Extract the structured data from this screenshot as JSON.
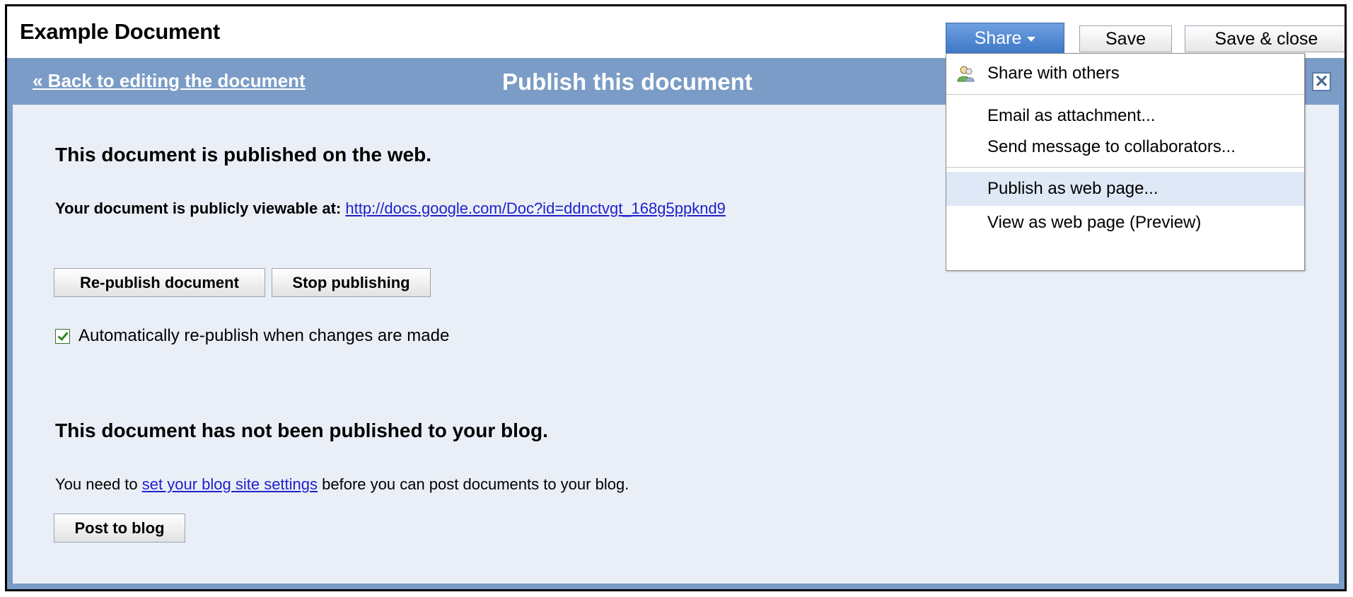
{
  "document": {
    "title": "Example Document"
  },
  "toolbar": {
    "share_label": "Share",
    "save_label": "Save",
    "save_close_label": "Save & close"
  },
  "publish_header": {
    "back_link": "« Back to editing the document",
    "title": "Publish this document",
    "close_icon": "close-x-icon"
  },
  "web_publish": {
    "heading": "This document is published on the web.",
    "viewable_prefix": "Your document is publicly viewable at:",
    "url": "http://docs.google.com/Doc?id=ddnctvgt_168g5ppknd9",
    "republish_button": "Re-publish document",
    "stop_button": "Stop publishing",
    "auto_republish_label": "Automatically re-publish when changes are made",
    "auto_republish_checked": true
  },
  "blog_publish": {
    "heading": "This document has not been published to your blog.",
    "text_before": "You need to",
    "settings_link": "set your blog site settings",
    "text_after": "before you can post documents to your blog.",
    "post_button": "Post to blog"
  },
  "share_menu": {
    "items": [
      {
        "label": "Share with others",
        "icon": "people-icon"
      },
      {
        "label": "Email as attachment..."
      },
      {
        "label": "Send message to collaborators..."
      },
      {
        "label": "Publish as web page...",
        "highlighted": true
      },
      {
        "label": "View as web page (Preview)"
      }
    ]
  },
  "colors": {
    "header_blue": "#7a9cc6",
    "panel_bg": "#eaeff7",
    "link_blue": "#2020cc",
    "share_button_blue": "#3f78c8",
    "menu_highlight": "#dfe8f6"
  }
}
